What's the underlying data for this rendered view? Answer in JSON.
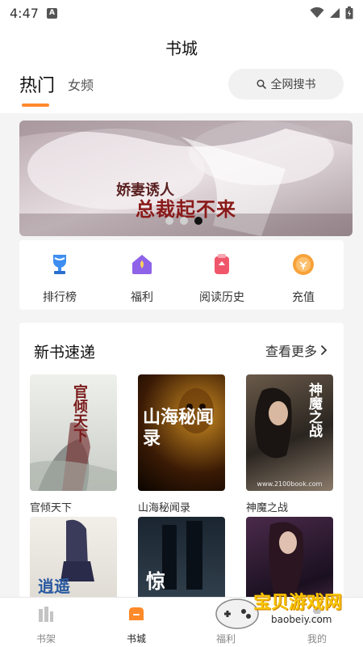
{
  "status": {
    "time": "4:47",
    "a_badge": "A"
  },
  "header": {
    "title": "书城",
    "tabs": [
      {
        "label": "热门"
      },
      {
        "label": "女频"
      }
    ],
    "search": {
      "label": "全网搜书"
    }
  },
  "banner": {
    "title": "总裁起不来",
    "subtitle_top": "娇妻诱人",
    "slide_count": 3,
    "active_slide": 3
  },
  "quick_links": [
    {
      "label": "排行榜",
      "icon": "trophy-icon",
      "color": "#3d8ef0"
    },
    {
      "label": "福利",
      "icon": "gift-house-icon",
      "color": "#8e63e8"
    },
    {
      "label": "阅读历史",
      "icon": "history-icon",
      "color": "#f0566a"
    },
    {
      "label": "充值",
      "icon": "coin-icon",
      "color": "#f8a23a"
    }
  ],
  "new_books": {
    "title": "新书速递",
    "more_label": "查看更多",
    "books": [
      {
        "title": "官倾天下",
        "cover_text": "官倾天下"
      },
      {
        "title": "山海秘闻录",
        "cover_text": "山海秘闻录"
      },
      {
        "title": "神魔之战",
        "cover_text": "神魔之战",
        "cover_site": "www.2100book.com"
      },
      {
        "title": "",
        "cover_text": "逍遥"
      },
      {
        "title": "",
        "cover_text": "惊"
      },
      {
        "title": "",
        "cover_text": ""
      }
    ]
  },
  "tabbar": {
    "items": [
      {
        "label": "书架",
        "icon": "bookshelf-icon"
      },
      {
        "label": "书城",
        "icon": "bookstore-icon"
      },
      {
        "label": "福利",
        "icon": "welfare-icon"
      },
      {
        "label": "我的",
        "icon": "profile-icon"
      }
    ],
    "active_index": 1
  },
  "watermark": {
    "text": "宝贝游戏网",
    "url": "baobeiy.com"
  },
  "colors": {
    "accent": "#ff8a2a",
    "watermark": "#f7c400"
  }
}
